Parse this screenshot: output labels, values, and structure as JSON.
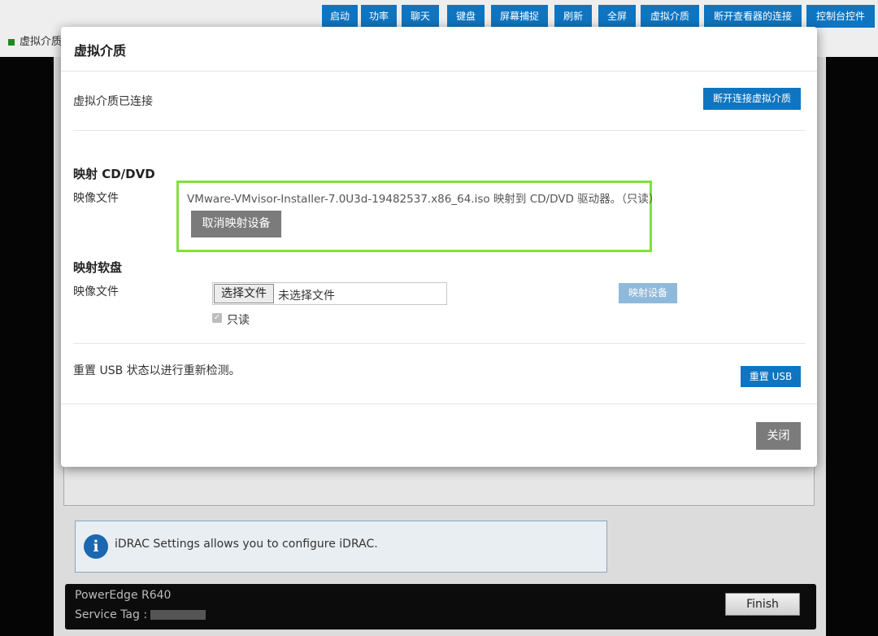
{
  "toolbar": {
    "buttons": [
      "启动",
      "功率",
      "聊天",
      "键盘",
      "屏幕捕捉",
      "刷新",
      "全屏",
      "虚拟介质",
      "断开查看器的连接",
      "控制台控件"
    ]
  },
  "background": {
    "status_label": "虚拟介质",
    "info_text": "iDRAC Settings allows you to configure iDRAC.",
    "model": "PowerEdge R640",
    "service_tag_label": "Service Tag :",
    "finish_label": "Finish"
  },
  "modal": {
    "title": "虚拟介质",
    "connected_text": "虚拟介质已连接",
    "disconnect_button": "断开连接虚拟介质",
    "cd": {
      "heading": "映射 CD/DVD",
      "image_label": "映像文件",
      "mapped_text": "VMware-VMvisor-Installer-7.0U3d-19482537.x86_64.iso 映射到 CD/DVD 驱动器。（只读）",
      "unmap_button": "取消映射设备"
    },
    "floppy": {
      "heading": "映射软盘",
      "image_label": "映像文件",
      "choose_file_button": "选择文件",
      "no_file_text": "未选择文件",
      "map_button": "映射设备",
      "readonly_label": "只读"
    },
    "usb": {
      "reset_text": "重置 USB 状态以进行重新检测。",
      "reset_button": "重置 USB"
    },
    "close_button": "关闭"
  },
  "colors": {
    "primary_blue": "#0f75c0",
    "highlight_green": "#7fe23a",
    "gray_button": "#7b7b7b"
  }
}
